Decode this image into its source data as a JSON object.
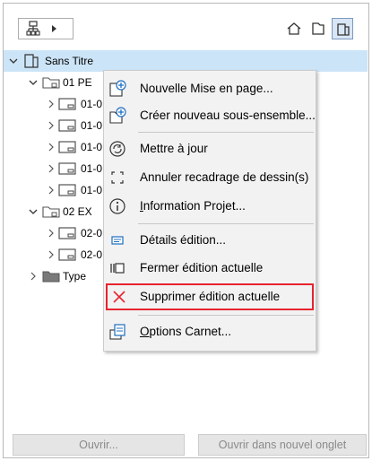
{
  "toolbar": {
    "left_button_icon": "tree-view-icon",
    "left_button_arrow": "triangle-right-icon",
    "view_buttons": [
      {
        "icon": "project-map-icon"
      },
      {
        "icon": "view-map-icon"
      },
      {
        "icon": "layout-book-icon",
        "active": true
      }
    ]
  },
  "tree": {
    "root": {
      "label": "Sans Titre",
      "expanded": true
    },
    "items": [
      {
        "label": "01 PE",
        "level": 1,
        "expanded": true,
        "icon": "layout-folder-icon"
      },
      {
        "label": "01-0",
        "level": 2
      },
      {
        "label": "01-0",
        "level": 2
      },
      {
        "label": "01-0",
        "level": 2
      },
      {
        "label": "01-0",
        "level": 2
      },
      {
        "label": "01-0",
        "level": 2
      },
      {
        "label": "02 EX",
        "level": 1,
        "expanded": true,
        "icon": "layout-folder-icon"
      },
      {
        "label": "02-0",
        "level": 2
      },
      {
        "label": "02-0",
        "level": 2
      },
      {
        "label": "Type",
        "level": 1,
        "expanded": false,
        "icon": "folder-icon"
      }
    ]
  },
  "context_menu": {
    "items": [
      {
        "label": "Nouvelle Mise en page...",
        "icon": "new-layout-icon"
      },
      {
        "label": "Créer nouveau sous-ensemble...",
        "icon": "new-subset-icon"
      },
      {
        "label": "Mettre à jour",
        "icon": "update-icon"
      },
      {
        "label": "Annuler recadrage de dessin(s)",
        "icon": "cancel-crop-icon"
      },
      {
        "label_pre": "",
        "label_u": "I",
        "label_post": "nformation Projet...",
        "icon": "info-icon"
      },
      {
        "label": "Détails édition...",
        "icon": "issue-details-icon"
      },
      {
        "label": "Fermer édition actuelle",
        "icon": "close-issue-icon"
      },
      {
        "label": "Supprimer édition actuelle",
        "icon": "delete-x-icon",
        "highlighted": true,
        "highlight_color": "#e8232f"
      },
      {
        "label_pre": "",
        "label_u": "O",
        "label_post": "ptions Carnet...",
        "icon": "book-options-icon"
      }
    ]
  },
  "footer": {
    "open_label": "Ouvrir...",
    "open_new_tab_label": "Ouvrir dans nouvel onglet"
  },
  "colors": {
    "selection": "#cce4f7",
    "accent_blue": "#1f6fbf",
    "highlight_red": "#e8232f",
    "disabled_text": "#8a8a8a"
  }
}
